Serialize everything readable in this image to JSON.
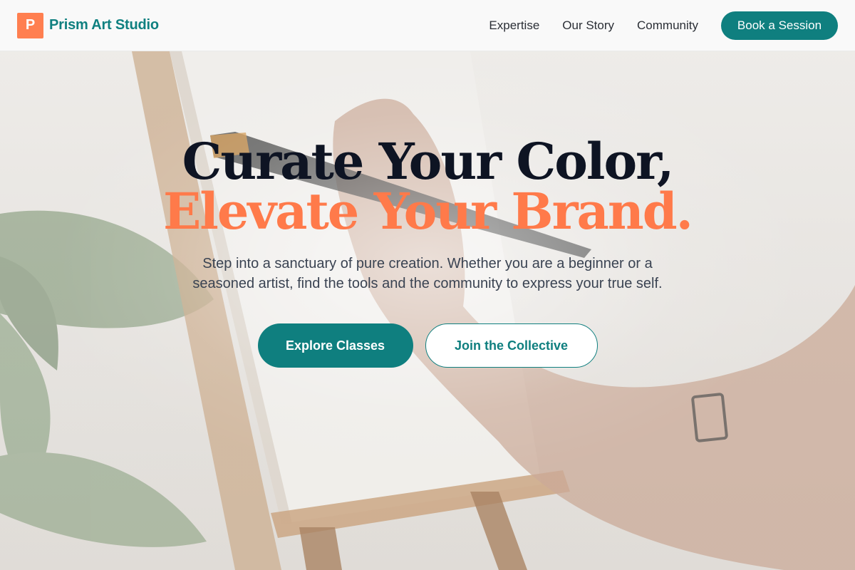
{
  "header": {
    "logo_letter": "P",
    "brand_name": "Prism Art Studio",
    "nav": [
      "Expertise",
      "Our Story",
      "Community"
    ],
    "cta_label": "Book a Session"
  },
  "hero": {
    "headline_line1": "Curate Your Color,",
    "headline_line2": "Elevate Your Brand.",
    "subtitle": "Step into a sanctuary of pure creation. Whether you are a beginner or a seasoned artist, find the tools and the community to express your true self.",
    "primary_button": "Explore Classes",
    "secondary_button": "Join the Collective",
    "background": "hand-painting-easel-photo"
  },
  "colors": {
    "accent_teal": "#0f7f7f",
    "accent_coral": "#ff7a4a",
    "heading_dark": "#0e1423",
    "logo_bg": "#ff7f50"
  }
}
